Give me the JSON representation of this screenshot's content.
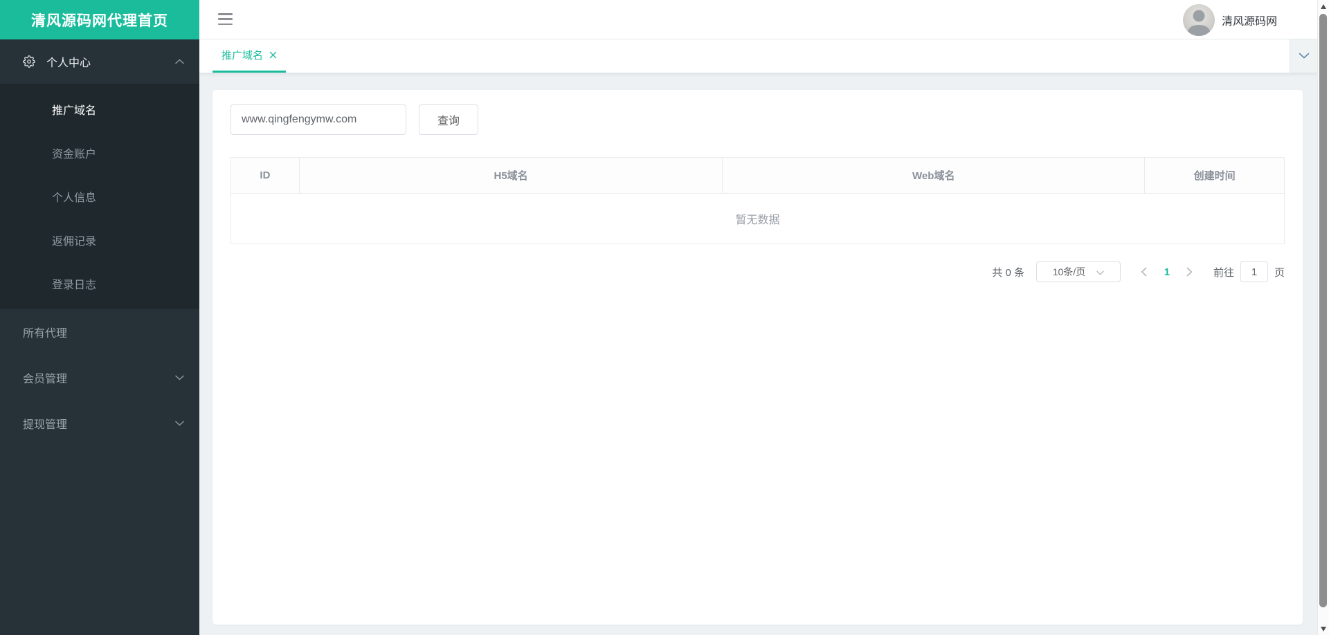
{
  "app": {
    "logo_title": "清风源码网代理首页",
    "user_name": "清风源码网"
  },
  "sidebar": {
    "personal_center": {
      "label": "个人中心",
      "expanded": true
    },
    "submenu": [
      {
        "label": "推广域名",
        "active": true
      },
      {
        "label": "资金账户"
      },
      {
        "label": "个人信息"
      },
      {
        "label": "返佣记录"
      },
      {
        "label": "登录日志"
      }
    ],
    "items": [
      {
        "label": "所有代理"
      },
      {
        "label": "会员管理",
        "collapsed": true
      },
      {
        "label": "提现管理",
        "collapsed": true
      }
    ]
  },
  "tabbar": {
    "active_tab": "推广域名"
  },
  "toolbar": {
    "search_value": "www.qingfengymw.com",
    "query_label": "查询"
  },
  "table": {
    "columns": [
      "ID",
      "H5域名",
      "Web域名",
      "创建时间"
    ],
    "rows": [],
    "empty_text": "暂无数据"
  },
  "pagination": {
    "total_text": "共 0 条",
    "page_size": "10条/页",
    "current_page": "1",
    "goto_label": "前往",
    "goto_value": "1",
    "page_unit": "页"
  },
  "colors": {
    "accent_teal": "#1abc9c",
    "sidebar_bg": "#263138",
    "submenu_bg": "#1f282d",
    "page_bg": "#eef1f3"
  },
  "icons": {
    "hamburger": "three horizontal bars",
    "gear": "settings cog outline",
    "chevron_up": "caret up",
    "chevron_down": "caret down",
    "tab_close": "x cross",
    "avatar": "user photo circle"
  }
}
